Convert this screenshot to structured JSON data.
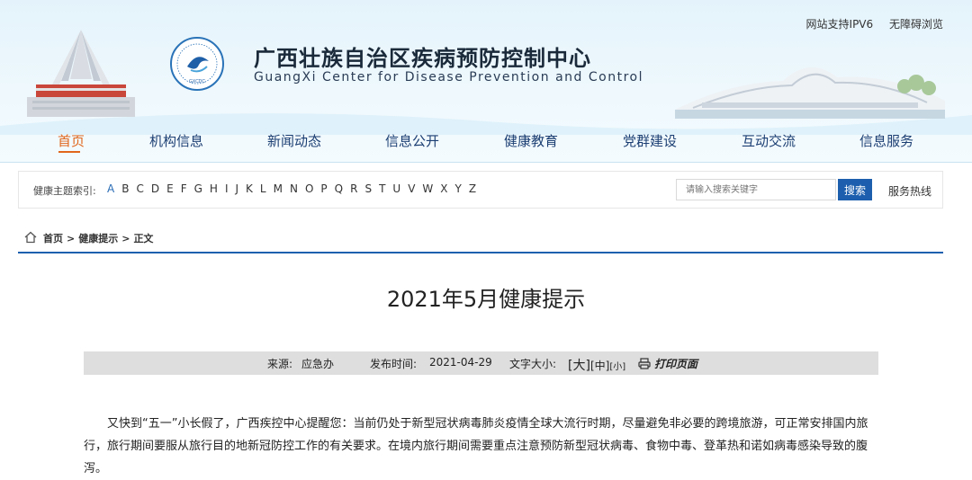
{
  "top_links": [
    "网站支持IPV6",
    "无障碍浏览"
  ],
  "site": {
    "title": "广西壮族自治区疾病预防控制中心",
    "subtitle": "GuangXi Center for Disease Prevention and Control",
    "logo_text": "GXCDC"
  },
  "nav": {
    "items": [
      {
        "label": "首页",
        "active": true
      },
      {
        "label": "机构信息"
      },
      {
        "label": "新闻动态"
      },
      {
        "label": "信息公开"
      },
      {
        "label": "健康教育"
      },
      {
        "label": "党群建设"
      },
      {
        "label": "互动交流"
      },
      {
        "label": "信息服务"
      }
    ]
  },
  "index": {
    "label": "健康主题索引:",
    "letters": [
      "A",
      "B",
      "C",
      "D",
      "E",
      "F",
      "G",
      "H",
      "I",
      "J",
      "K",
      "L",
      "M",
      "N",
      "O",
      "P",
      "Q",
      "R",
      "S",
      "T",
      "U",
      "V",
      "W",
      "X",
      "Y",
      "Z"
    ]
  },
  "search": {
    "placeholder": "请输入搜索关键字",
    "button": "搜索"
  },
  "hotline": "服务热线",
  "breadcrumb": {
    "home": "首页",
    "section": "健康提示",
    "current": "正文",
    "sep": ">"
  },
  "article": {
    "title": "2021年5月健康提示",
    "source_label": "来源:",
    "source": "应急办",
    "date_label": "发布时间:",
    "date": "2021-04-29",
    "font_size_label": "文字大小:",
    "font_sizes": [
      "[大]",
      "[中]",
      "[小]"
    ],
    "print": "打印页面",
    "body": "又快到“五一”小长假了，广西疾控中心提醒您：当前仍处于新型冠状病毒肺炎疫情全球大流行时期，尽量避免非必要的跨境旅游，可正常安排国内旅行，旅行期间要服从旅行目的地新冠防控工作的有关要求。在境内旅行期间需要重点注意预防新型冠状病毒、食物中毒、登革热和诺如病毒感染导致的腹泻。"
  },
  "colors": {
    "nav_text": "#1b3e72",
    "active": "#e0661c",
    "accent_blue": "#1d5fae",
    "meta_bg": "#dedede"
  }
}
